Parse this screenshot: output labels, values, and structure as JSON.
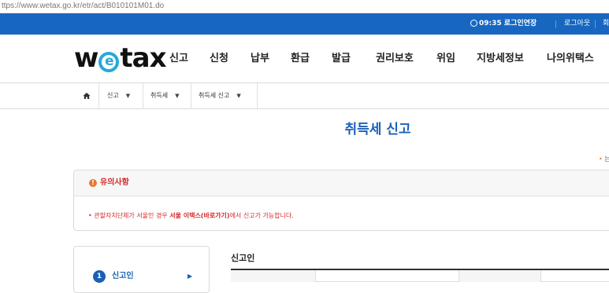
{
  "browser": {
    "url": "ttps://www.wetax.go.kr/etr/act/B010101M01.do"
  },
  "topbar": {
    "time": "09:35",
    "extend_login": "로그인연장",
    "logout": "로그아웃",
    "member_info": "회"
  },
  "logo": {
    "left": "w",
    "circle_letter": "e",
    "right": "tax"
  },
  "gnb": {
    "items": [
      "신고",
      "신청",
      "납부",
      "환급",
      "발급",
      "권리보호",
      "위임",
      "지방세정보",
      "나의위택스"
    ]
  },
  "breadcrumb": {
    "level1": "신고",
    "level2": "취득세",
    "level3": "취득세 신고"
  },
  "page": {
    "title": "취득세 신고",
    "required_mark": "•",
    "required_text": "는"
  },
  "notice": {
    "icon_glyph": "!",
    "title": "유의사항",
    "body_prefix": "• 관할자치단체가 서울인 경우 ",
    "body_link": "서울 이택스(바로가기)",
    "body_suffix": "에서 신고가 가능합니다."
  },
  "steps": [
    {
      "number": "1",
      "label": "신고인"
    }
  ],
  "form": {
    "section_title": "신고인"
  },
  "colors": {
    "brand_blue": "#1767c0",
    "title_blue": "#1b61b7",
    "alert_red": "#d42a2a",
    "accent_orange": "#e8772e",
    "logo_cyan": "#29a8d8"
  }
}
